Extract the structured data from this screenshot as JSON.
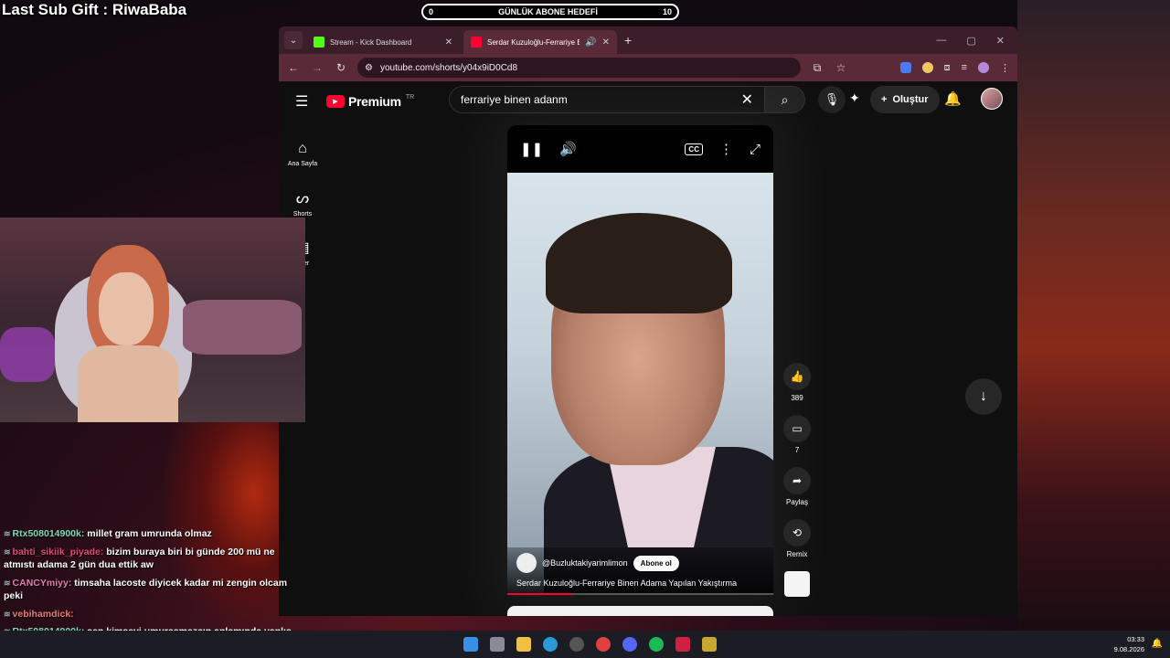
{
  "overlay": {
    "sub_gift": "Last Sub Gift : RiwaBaba",
    "goal": {
      "label": "GÜNLÜK ABONE HEDEFİ",
      "current": "0",
      "target": "10"
    }
  },
  "browser": {
    "tabs": [
      {
        "title": "Stream - Kick Dashboard",
        "active": false
      },
      {
        "title": "Serdar Kuzuloğlu-Ferrariye Bin",
        "active": true
      }
    ],
    "url": "youtube.com/shorts/y04x9iD0Cd8"
  },
  "youtube": {
    "logo_text": "Premium",
    "logo_region": "TR",
    "search_value": "ferrariye binen adanm",
    "create_label": "Oluştur",
    "sidebar": [
      {
        "label": "Ana Sayfa",
        "icon": "home-icon"
      },
      {
        "label": "Shorts",
        "icon": "shorts-icon"
      },
      {
        "label": "likler",
        "icon": "subscriptions-icon"
      }
    ],
    "video": {
      "channel": "@Buzluktakiyarimlimon",
      "subscribe_label": "Abone ol",
      "title": "Serdar Kuzuloğlu-Ferrariye Binen Adama Yapılan Yakıştırma",
      "watermark": "buzluktakiyarimlimon",
      "progress": 0.24
    },
    "actions": [
      {
        "label": "389",
        "icon": "like-icon"
      },
      {
        "label": "7",
        "icon": "comment-icon"
      },
      {
        "label": "Paylaş",
        "icon": "share-icon"
      },
      {
        "label": "Remix",
        "icon": "remix-icon"
      }
    ]
  },
  "chat": [
    {
      "user": "Rtx508014900k:",
      "color": "#7fd9b8",
      "msg": "millet gram umrunda olmaz"
    },
    {
      "user": "bahti_sikiik_piyade:",
      "color": "#e0497a",
      "msg": "bizim buraya biri bi günde 200 mü ne atmıstı adama 2 gün dua ettik aw"
    },
    {
      "user": "CANCYmiyy:",
      "color": "#e97ab0",
      "msg": "timsaha lacoste diyicek kadar mi zengin olcam peki"
    },
    {
      "user": "vebihamdick:",
      "color": "#e97a7a",
      "msg": ""
    },
    {
      "user": "Rtx508014900k:",
      "color": "#7fd9b8",
      "msg": "sen kimseyi umursamazsın anlamında yanlış okudun xd"
    }
  ],
  "taskbar": {
    "time": "03:33",
    "date": "9.08.2026"
  }
}
